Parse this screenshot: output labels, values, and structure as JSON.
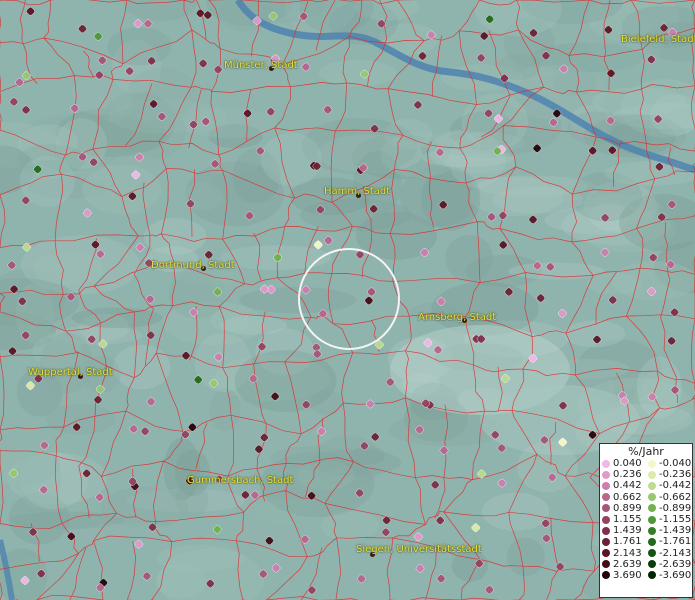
{
  "map": {
    "cities": [
      {
        "name": "Münster, Stadt"
      },
      {
        "name": "Bielefeld, Stadt"
      },
      {
        "name": "Hamm, Stadt"
      },
      {
        "name": "Dortmund, Stadt"
      },
      {
        "name": "Arnsberg, Stadt"
      },
      {
        "name": "Wuppertal, Stadt"
      },
      {
        "name": "Gummersbach, Stadt"
      },
      {
        "name": "Siegen, Universitätsstadt"
      }
    ]
  },
  "legend": {
    "title": "%/Jahr",
    "positive": [
      {
        "label": "0.040",
        "color": "#f0b8e8"
      },
      {
        "label": "0.236",
        "color": "#e09ac8"
      },
      {
        "label": "0.442",
        "color": "#cc7fae"
      },
      {
        "label": "0.662",
        "color": "#b8668f"
      },
      {
        "label": "0.899",
        "color": "#a65478"
      },
      {
        "label": "1.155",
        "color": "#934262"
      },
      {
        "label": "1.439",
        "color": "#7d3049"
      },
      {
        "label": "1.761",
        "color": "#6b2236"
      },
      {
        "label": "2.143",
        "color": "#581626"
      },
      {
        "label": "2.639",
        "color": "#420d18"
      },
      {
        "label": "3.690",
        "color": "#24040a"
      }
    ],
    "negative": [
      {
        "label": "-0.040",
        "color": "#f4f8c8"
      },
      {
        "label": "-0.236",
        "color": "#dcebaa"
      },
      {
        "label": "-0.442",
        "color": "#bcdc8e"
      },
      {
        "label": "-0.662",
        "color": "#98c870"
      },
      {
        "label": "-0.899",
        "color": "#72b052"
      },
      {
        "label": "-1.155",
        "color": "#4e983a"
      },
      {
        "label": "-1.439",
        "color": "#347e28"
      },
      {
        "label": "-1.761",
        "color": "#226a1c"
      },
      {
        "label": "-2.143",
        "color": "#155414"
      },
      {
        "label": "-2.639",
        "color": "#0b3e0c"
      },
      {
        "label": "-3.690",
        "color": "#042406"
      }
    ]
  }
}
